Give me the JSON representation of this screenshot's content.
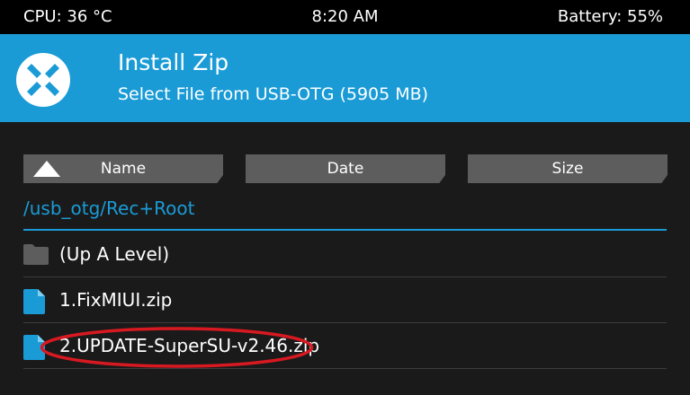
{
  "status_bar": {
    "cpu": "CPU: 36 °C",
    "time": "8:20 AM",
    "battery": "Battery: 55%"
  },
  "header": {
    "title": "Install Zip",
    "subtitle": "Select File from USB-OTG (5905 MB)",
    "logo_icon": "twrp-logo-icon"
  },
  "sort": {
    "name_label": "Name",
    "date_label": "Date",
    "size_label": "Size",
    "active": "name",
    "direction_icon": "triangle-up-icon"
  },
  "path": "/usb_otg/Rec+Root",
  "files": [
    {
      "name": "(Up A Level)",
      "icon": "folder-icon"
    },
    {
      "name": "1.FixMIUI.zip",
      "icon": "file-icon"
    },
    {
      "name": "2.UPDATE-SuperSU-v2.46.zip",
      "icon": "file-icon",
      "annotated": true
    }
  ],
  "colors": {
    "accent": "#1a9bd6",
    "background": "#1a1a1a",
    "button": "#5d5d5d",
    "highlight_annotation": "#d71921"
  }
}
